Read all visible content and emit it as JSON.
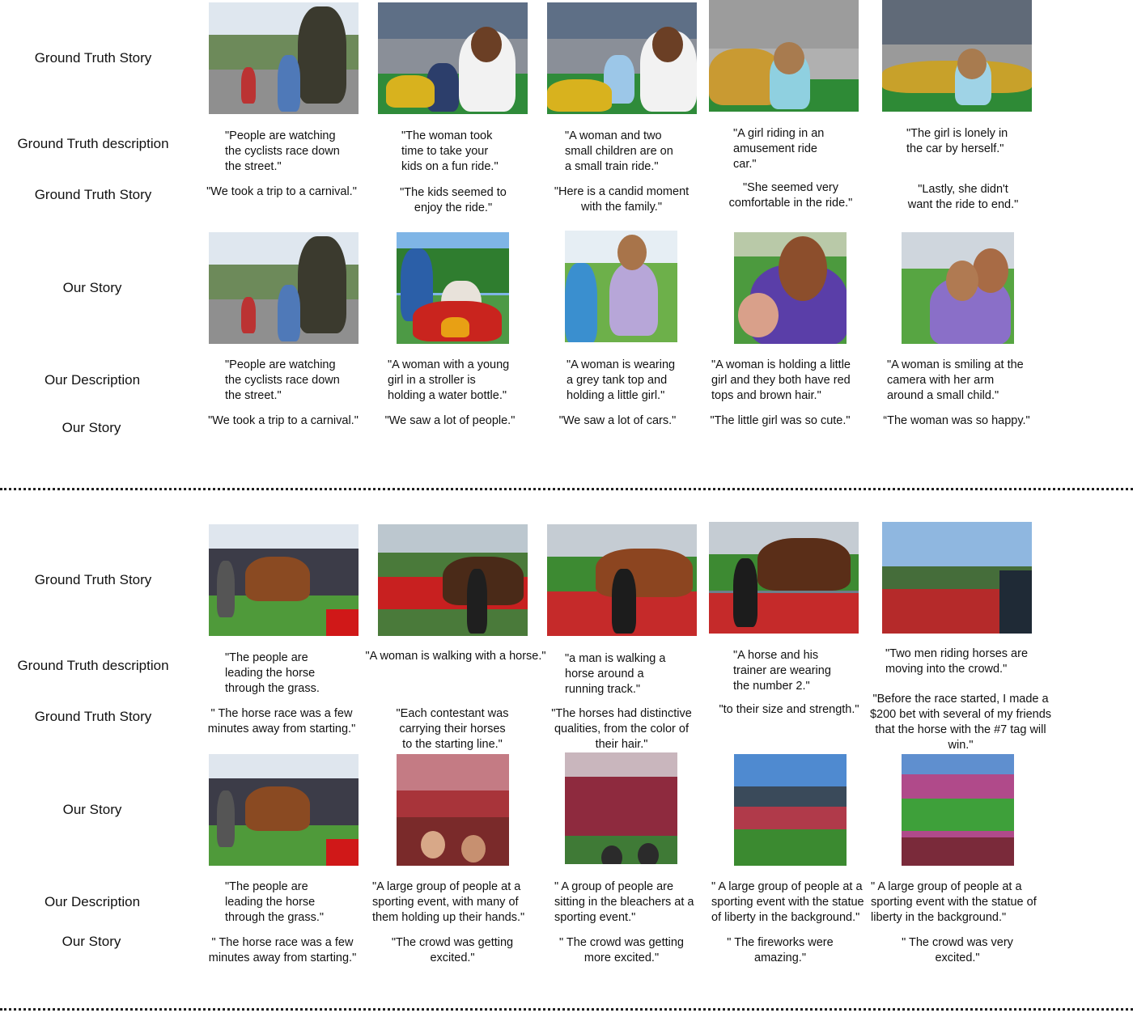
{
  "sections": [
    {
      "labels": {
        "gt_story": "Ground Truth Story",
        "gt_description": "Ground Truth description",
        "gt_story_2": "Ground Truth Story",
        "our_story": "Our Story",
        "our_description": "Our Description",
        "our_story_2": "Our Story"
      },
      "gt_descriptions": [
        "\"People are watching\nthe cyclists race down\nthe street.\"",
        "\"The woman took\ntime to take your\nkids on a fun ride.\"",
        "\"A woman and two\nsmall children are on\na small train ride.\"",
        "\"A girl riding in an\namusement ride\ncar.\"",
        "\"The girl is lonely in\nthe car by herself.\""
      ],
      "gt_stories": [
        "\"We took a trip to a carnival.\"",
        "\"The kids seemed to\nenjoy the ride.\"",
        "\"Here is a candid moment\nwith the family.\"",
        "\"She seemed very\ncomfortable in the ride.\"",
        "\"Lastly, she didn't\nwant the ride to end.\""
      ],
      "our_descriptions": [
        "\"People are watching\nthe cyclists race down\nthe street.\"",
        "\"A woman with a young\ngirl in a stroller is\nholding a water bottle.\"",
        "\"A woman is wearing\na grey tank top and\nholding a little girl.\"",
        "\"A woman is holding a little\ngirl and they both have red\ntops and brown hair.\"",
        "\"A woman is smiling at the\ncamera with her arm\naround a small child.\""
      ],
      "our_stories": [
        "\"We took a trip to a carnival.\"",
        "\"We saw a lot of people.\"",
        "\"We saw a lot of cars.\"",
        "\"The little girl was so cute.\"",
        "“The woman was so happy.\""
      ]
    },
    {
      "labels": {
        "gt_story": "Ground Truth Story",
        "gt_description": "Ground Truth description",
        "gt_story_2": "Ground Truth Story",
        "our_story": "Our Story",
        "our_description": "Our Description",
        "our_story_2": "Our Story"
      },
      "gt_descriptions": [
        "\"The people are\nleading the horse\nthrough the grass.",
        "\"A woman is walking with a horse.\"",
        "\"a man is walking a\nhorse around a\nrunning track.\"",
        "\"A horse and his\ntrainer are wearing\nthe number 2.\"",
        "\"Two men riding horses are\nmoving into the crowd.\""
      ],
      "gt_stories": [
        "\" The horse race was a few\nminutes away from starting.\"",
        "\"Each contestant was\ncarrying their horses\nto the starting line.\"",
        "\"The horses had distinctive\nqualities, from the color of\ntheir hair.\"",
        "\"to their size and strength.\"",
        "\"Before the race started, I made a\n$200 bet with several of my friends\nthat the horse with the #7 tag will\nwin.\""
      ],
      "our_descriptions": [
        "\"The people are\nleading the horse\nthrough the grass.\"",
        "\"A large group of people at a\nsporting event, with many of\nthem holding up their hands.\"",
        "\" A group of people are\nsitting in the bleachers at a\nsporting event.\"",
        "\" A large group of people at a\nsporting event with the statue\nof liberty in the background.\"",
        "\" A large group of people at a\nsporting event with the statue of\nliberty in the background.\""
      ],
      "our_stories": [
        "\" The horse race was a few\nminutes away from starting.\"",
        "\"The crowd was getting\nexcited.\"",
        "\" The crowd was getting\nmore excited.\"",
        "\" The fireworks were\namazing.\"",
        "\" The crowd was very\nexcited.\""
      ]
    }
  ],
  "photos": {
    "gt_row_1": [
      "cyclists-street-photo",
      "woman-kids-ride-photo",
      "family-train-ride-photo",
      "girl-ride-car-photo",
      "girl-alone-ride-photo"
    ],
    "our_row_1": [
      "cyclists-street-photo",
      "woman-girl-stroller-photo",
      "woman-holding-girl-photo",
      "woman-girl-red-tops-photo",
      "woman-child-smiling-photo"
    ],
    "gt_row_2": [
      "horse-paddock-photo",
      "woman-walking-horse-photo",
      "man-horse-track-photo",
      "horse-number-2-photo",
      "riders-crowd-photo"
    ],
    "our_row_2": [
      "horse-paddock-photo",
      "stadium-crowd-hands-photo",
      "bleachers-crowd-photo",
      "stadium-city-photo",
      "stadium-crowd-field-photo"
    ]
  }
}
